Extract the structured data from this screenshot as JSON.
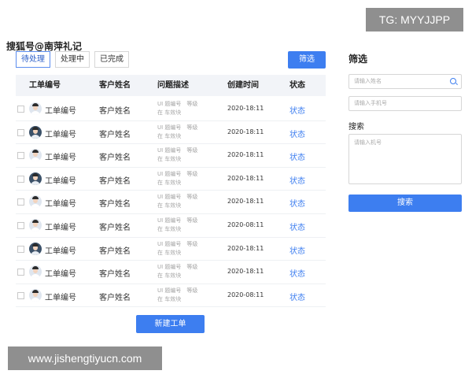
{
  "watermarks": {
    "top_right": "TG: MYYJJPP",
    "top_left": "搜狐号@南萍礼记",
    "bottom_left": "www.jishengtiyucn.com"
  },
  "tabs": [
    {
      "label": "待处理",
      "active": true
    },
    {
      "label": "处理中",
      "active": false
    },
    {
      "label": "已完成",
      "active": false
    }
  ],
  "filter_button": "筛选",
  "table": {
    "headers": [
      "工单编号",
      "客户姓名",
      "问题描述",
      "创建时间",
      "状态"
    ],
    "rows": [
      {
        "id": "工单编号",
        "customer": "客户姓名",
        "desc_line1": "UI 题编号　等级",
        "desc_line2": "在 车效块",
        "time": "2020-18:11",
        "status": "状态",
        "avatar": "light"
      },
      {
        "id": "工单编号",
        "customer": "客户姓名",
        "desc_line1": "UI 题编号　等级",
        "desc_line2": "在 车效块",
        "time": "2020-18:11",
        "status": "状态",
        "avatar": "dark"
      },
      {
        "id": "工单编号",
        "customer": "客户姓名",
        "desc_line1": "UI 题编号　等级",
        "desc_line2": "在 车效块",
        "time": "2020-18:11",
        "status": "状态",
        "avatar": "light"
      },
      {
        "id": "工单编号",
        "customer": "客户姓名",
        "desc_line1": "UI 题编号　等级",
        "desc_line2": "在 车效块",
        "time": "2020-18:11",
        "status": "状态",
        "avatar": "dark"
      },
      {
        "id": "工单编号",
        "customer": "客户姓名",
        "desc_line1": "UI 题编号　等级",
        "desc_line2": "在 车效块",
        "time": "2020-18:11",
        "status": "状态",
        "avatar": "light"
      },
      {
        "id": "工单编号",
        "customer": "客户姓名",
        "desc_line1": "UI 题编号　等级",
        "desc_line2": "在 车效块",
        "time": "2020-08:11",
        "status": "状态",
        "avatar": "light"
      },
      {
        "id": "工单编号",
        "customer": "客户姓名",
        "desc_line1": "UI 题编号　等级",
        "desc_line2": "在 车效块",
        "time": "2020-18:11",
        "status": "状态",
        "avatar": "dark"
      },
      {
        "id": "工单编号",
        "customer": "客户姓名",
        "desc_line1": "UI 题编号　等级",
        "desc_line2": "在 车效块",
        "time": "2020-18:11",
        "status": "状态",
        "avatar": "light"
      },
      {
        "id": "工单编号",
        "customer": "客户姓名",
        "desc_line1": "UI 题编号　等级",
        "desc_line2": "在 车效块",
        "time": "2020-08:11",
        "status": "状态",
        "avatar": "light"
      }
    ]
  },
  "new_ticket_button": "新建工单",
  "side": {
    "title": "筛选",
    "name_placeholder": "请输入姓名",
    "phone_placeholder": "请输入手机号",
    "search_label": "搜索",
    "textarea_placeholder": "请输入机号",
    "search_button": "搜索"
  },
  "colors": {
    "accent": "#3d7ef0",
    "header_bg": "#f2f4f8"
  }
}
